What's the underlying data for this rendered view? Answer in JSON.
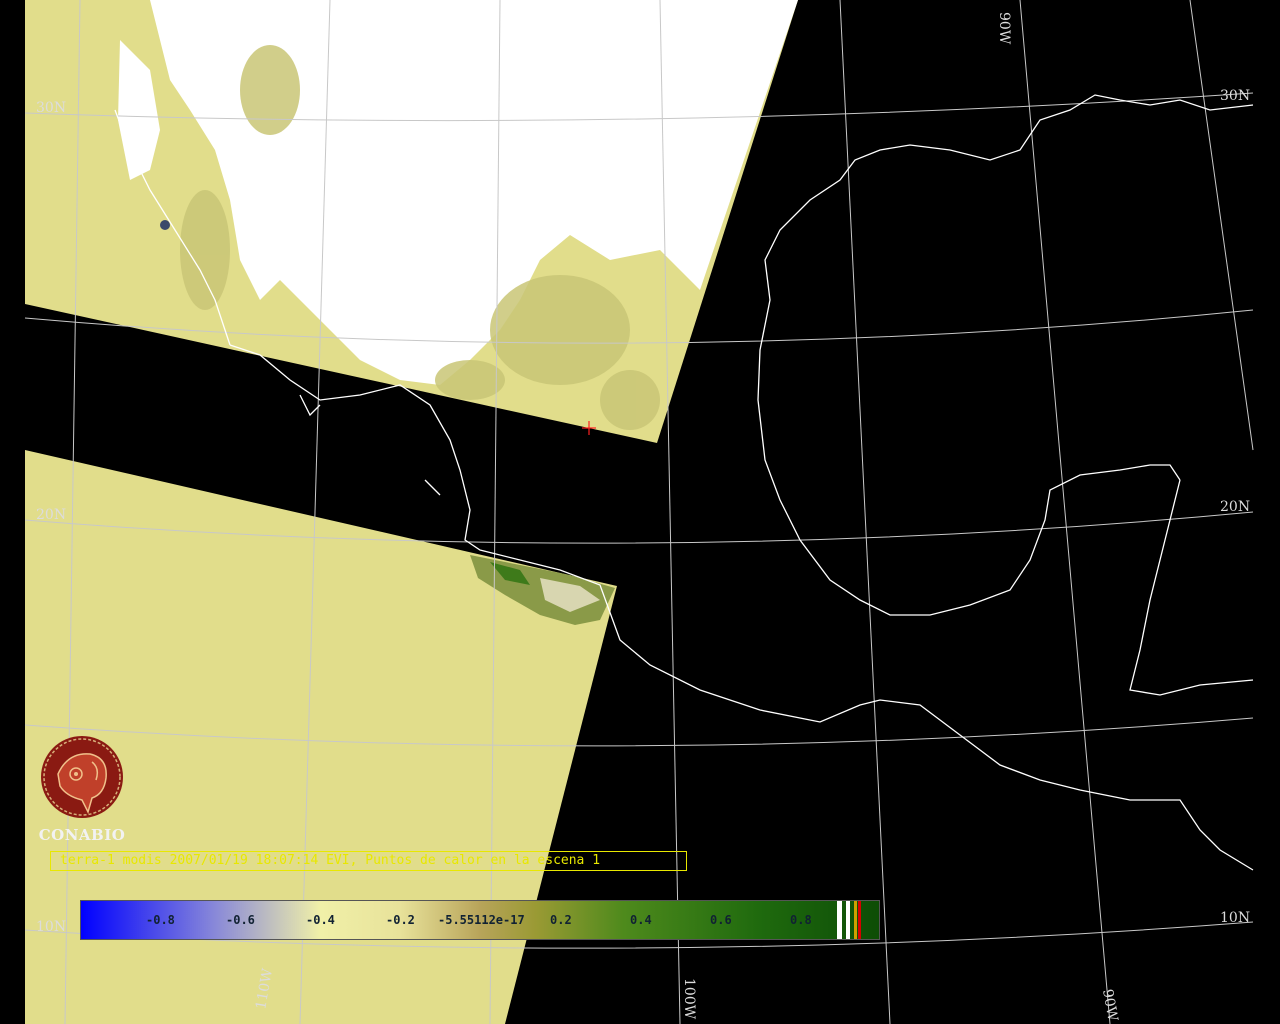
{
  "map": {
    "lat_labels": {
      "n30_left": "30N",
      "n30_right": "30N",
      "n20_left": "20N",
      "n20_right": "20N",
      "n10_left": "10N",
      "n10_right": "10N"
    },
    "lon_labels": {
      "w110": "110W",
      "w100": "100W",
      "w90_bottom": "90W",
      "w90_top": "90W"
    },
    "colors": {
      "background": "#000000",
      "grid": "#c8c8c8",
      "coastline": "#ffffff",
      "nodata": "#e1dd8b",
      "cloud": "#ffffff",
      "hotspot_marker": "#ff2020"
    }
  },
  "logo": {
    "icon": "conabio-emblem-icon",
    "name": "CONABIO"
  },
  "caption": {
    "text": "terra-1 modis 2007/01/19 18:07:14 EVI, Puntos de calor en la escena 1"
  },
  "colorbar": {
    "ticks": [
      "-0.8",
      "-0.6",
      "-0.4",
      "-0.2",
      "-5.55112e-17",
      "0.2",
      "0.4",
      "0.6",
      "0.8"
    ],
    "end_swatches": [
      "#ffffff",
      "#ffffff",
      "#cfa000",
      "#d80000"
    ]
  }
}
